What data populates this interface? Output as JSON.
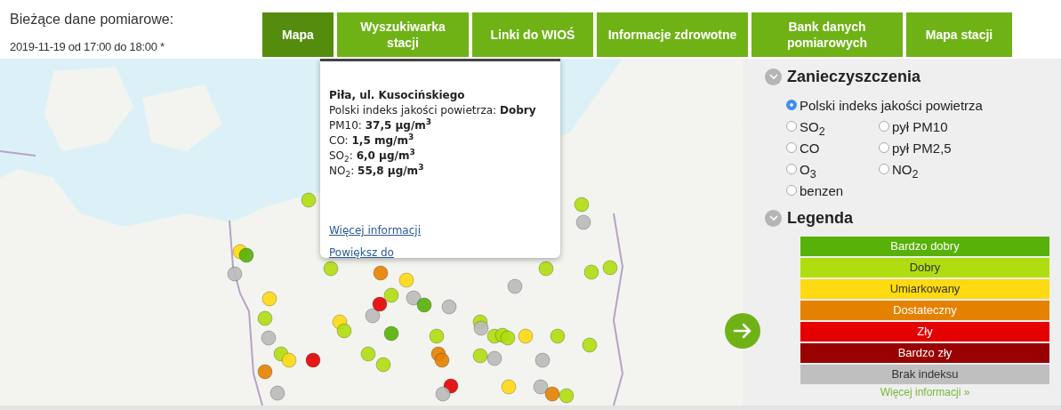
{
  "header": {
    "title": "Bieżące dane pomiarowe:",
    "time_range": "2019-11-19 od 17:00 do 18:00 *"
  },
  "tabs": [
    {
      "label": "Mapa",
      "selected": true
    },
    {
      "label": "Wyszukiwarka stacji",
      "selected": false
    },
    {
      "label": "Linki do WIOŚ",
      "selected": false
    },
    {
      "label": "Informacje zdrowotne",
      "selected": false
    },
    {
      "label": "Bank danych pomiarowych",
      "selected": false
    },
    {
      "label": "Mapa stacji",
      "selected": false
    }
  ],
  "popup": {
    "station": "Piła, ul. Kusocińskiego",
    "index_label": "Polski indeks jakości powietrza:",
    "index_value": "Dobry",
    "readings": [
      {
        "label": "PM10:",
        "value": "37,5 µg/m$^{3}$"
      },
      {
        "label": "CO:",
        "value": "1,5 mg/m$^{3}$"
      },
      {
        "label": "SO$_{2}$:",
        "value": "6,0 µg/m$^{3}$"
      },
      {
        "label": "NO$_{2}$:",
        "value": "55,8 µg/m$^{3}$"
      }
    ],
    "links": [
      "Więcej informacji",
      "Powiększ do"
    ]
  },
  "pollutants": {
    "title": "Zanieczyszczenia",
    "expanded": true,
    "options": [
      {
        "label": "Polski indeks jakości powietrza",
        "selected": true
      },
      {
        "label": "SO$_{2}$",
        "selected": false
      },
      {
        "label": "pył PM10",
        "selected": false
      },
      {
        "label": "CO",
        "selected": false
      },
      {
        "label": "pył PM2,5",
        "selected": false
      },
      {
        "label": "O$_{3}$",
        "selected": false
      },
      {
        "label": "NO$_{2}$",
        "selected": false
      },
      {
        "label": "benzen",
        "selected": false
      }
    ]
  },
  "legend": {
    "title": "Legenda",
    "expanded": true,
    "items": [
      {
        "label": "Bardzo dobry",
        "color": "#57b108"
      },
      {
        "label": "Dobry",
        "color": "#b0dd10"
      },
      {
        "label": "Umiarkowany",
        "color": "#ffd911"
      },
      {
        "label": "Dostateczny",
        "color": "#e58100"
      },
      {
        "label": "Zły",
        "color": "#e50000"
      },
      {
        "label": "Bardzo zły",
        "color": "#990000"
      },
      {
        "label": "Brak indeksu",
        "color": "#bfbfbf"
      }
    ],
    "more_link": "Więcej informacji »"
  }
}
